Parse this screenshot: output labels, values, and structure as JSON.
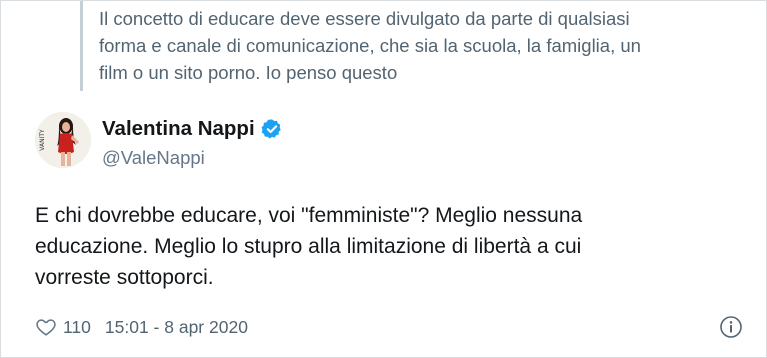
{
  "quoted_tweet": {
    "lines": [
      "Il concetto di educare deve essere divulgato da parte di qualsiasi",
      "forma e canale di comunicazione, che sia la scuola, la famiglia, un",
      "film o un sito porno. Io penso questo"
    ]
  },
  "author": {
    "display_name": "Valentina Nappi",
    "handle": "@ValeNappi",
    "verified": true,
    "avatar_icon": "profile-photo-avatar",
    "avatar_side_text": "VANITY"
  },
  "tweet": {
    "lines": [
      "E chi dovrebbe educare, voi \"femministe\"? Meglio nessuna",
      "educazione. Meglio lo stupro alla limitazione di libertà a cui",
      "vorreste sottoporci."
    ]
  },
  "footer": {
    "like_icon": "heart-icon",
    "like_count": "110",
    "timestamp": "15:01 - 8 apr 2020",
    "info_icon": "info-icon"
  },
  "colors": {
    "verified_badge": "#1da1f2",
    "secondary_text": "#657786",
    "primary_text": "#14171a",
    "thread_line": "#c4cfd6"
  }
}
